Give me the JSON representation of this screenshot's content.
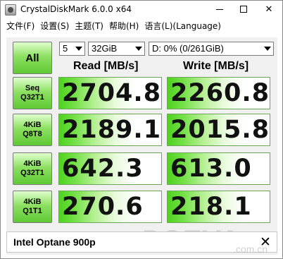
{
  "window": {
    "title": "CrystalDiskMark 6.0.0 x64",
    "minimize_icon": "minimize-icon",
    "maximize_icon": "maximize-icon",
    "close_glyph": "✕"
  },
  "menu": [
    "文件(F)",
    "设置(S)",
    "主题(T)",
    "帮助(H)",
    "语言(L)(Language)"
  ],
  "controls": {
    "all_label": "All",
    "count_value": "5",
    "size_value": "32GiB",
    "drive_value": "D: 0% (0/261GiB)"
  },
  "columns": {
    "read": "Read [MB/s]",
    "write": "Write [MB/s]"
  },
  "tests": [
    {
      "line1": "Seq",
      "line2": "Q32T1",
      "read": "2704.8",
      "write": "2260.8"
    },
    {
      "line1": "4KiB",
      "line2": "Q8T8",
      "read": "2189.1",
      "write": "2015.8"
    },
    {
      "line1": "4KiB",
      "line2": "Q32T1",
      "read": "642.3",
      "write": "613.0"
    },
    {
      "line1": "4KiB",
      "line2": "Q1T1",
      "read": "270.6",
      "write": "218.1"
    }
  ],
  "comment": {
    "text": "Intel Optane 900p",
    "clear_glyph": "✕"
  },
  "watermark": {
    "main": "PCEVA",
    "sub": ".com.cn"
  },
  "colors": {
    "accent_green": "#5ec934",
    "value_green": "#4fd21f"
  }
}
